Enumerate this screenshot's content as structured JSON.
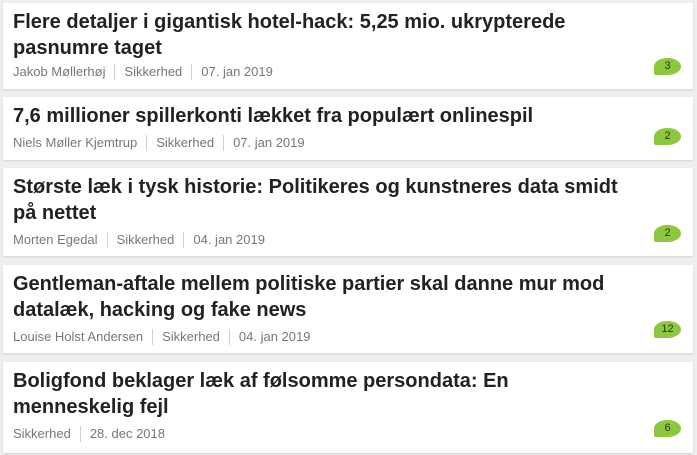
{
  "articles": [
    {
      "title": "Flere detaljer i gigantisk hotel-hack: 5,25 mio. ukrypterede pasnumre taget",
      "author": "Jakob Møllerhøj",
      "category": "Sikkerhed",
      "date": "07. jan 2019",
      "comments": "3"
    },
    {
      "title": "7,6 millioner spillerkonti lækket fra populært onlinespil",
      "author": "Niels Møller Kjemtrup",
      "category": "Sikkerhed",
      "date": "07. jan 2019",
      "comments": "2"
    },
    {
      "title": "Største læk i tysk historie: Politikeres og kunstneres data smidt på nettet",
      "author": "Morten Egedal",
      "category": "Sikkerhed",
      "date": "04. jan 2019",
      "comments": "2"
    },
    {
      "title": "Gentleman-aftale mellem politiske partier skal danne mur mod datalæk, hacking og fake news",
      "author": "Louise Holst Andersen",
      "category": "Sikkerhed",
      "date": "04. jan 2019",
      "comments": "12"
    },
    {
      "title": "Boligfond beklager læk af følsomme persondata: En menneskelig fejl",
      "category": "Sikkerhed",
      "date": "28. dec 2018",
      "comments": "6"
    }
  ]
}
